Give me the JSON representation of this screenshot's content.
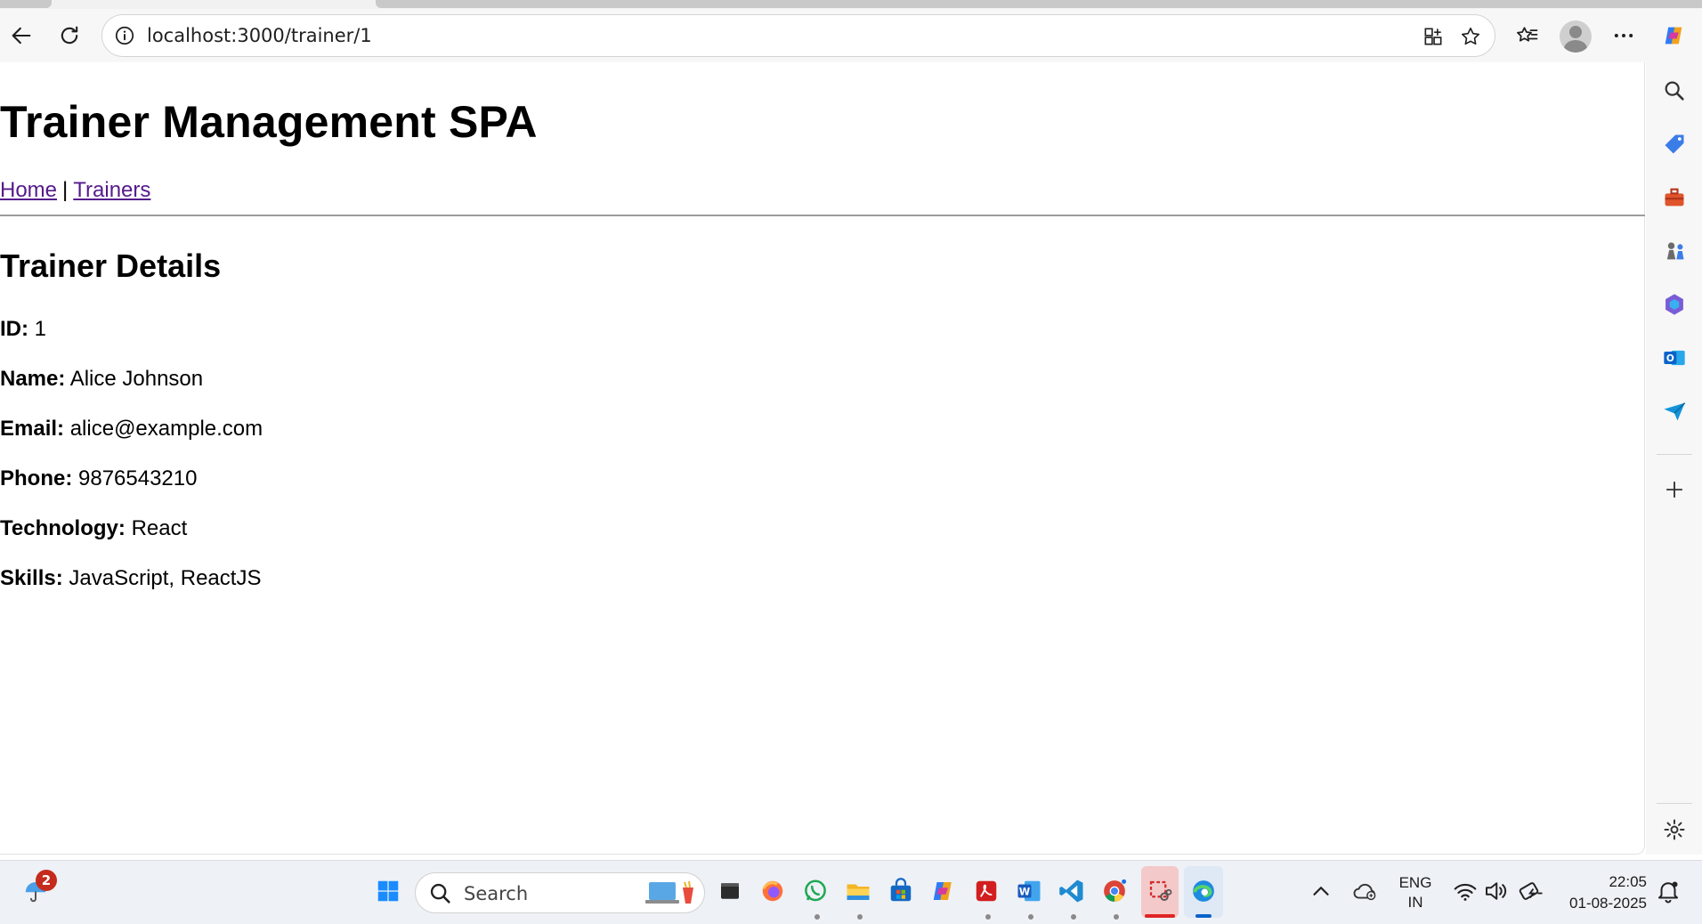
{
  "browser": {
    "url": "localhost:3000/trainer/1"
  },
  "page": {
    "app_title": "Trainer Management SPA",
    "nav": {
      "home": "Home",
      "separator": "|",
      "trainers": "Trainers"
    },
    "details_title": "Trainer Details",
    "fields": [
      {
        "label": "ID:",
        "value": "1"
      },
      {
        "label": "Name:",
        "value": "Alice Johnson"
      },
      {
        "label": "Email:",
        "value": "alice@example.com"
      },
      {
        "label": "Phone:",
        "value": "9876543210"
      },
      {
        "label": "Technology:",
        "value": "React"
      },
      {
        "label": "Skills:",
        "value": "JavaScript, ReactJS"
      }
    ]
  },
  "taskbar": {
    "weather_badge": "2",
    "search_placeholder": "Search",
    "language": {
      "line1": "ENG",
      "line2": "IN"
    },
    "time": "22:05",
    "date": "01-08-2025"
  },
  "colors": {
    "link_visited": "#551a8b",
    "edge_accent": "#0a64c9",
    "notification_red": "#c42b1c"
  }
}
